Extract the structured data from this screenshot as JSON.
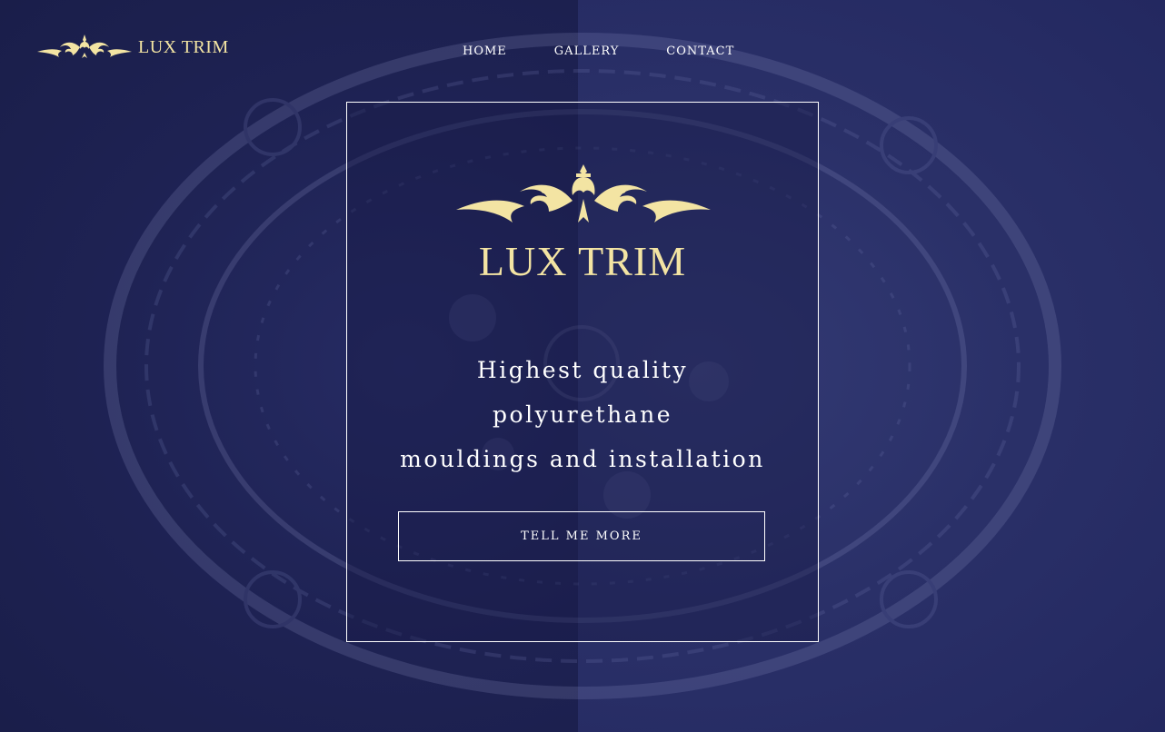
{
  "brand": {
    "name": "LUX TRIM",
    "logo_icon": "scroll-ornament-icon",
    "color": "#f3e4a3"
  },
  "nav": {
    "items": [
      "HOME",
      "GALLERY",
      "CONTACT"
    ]
  },
  "hero": {
    "logo_text": "LUX TRIM",
    "tagline": [
      "Highest quality",
      "polyurethane",
      "mouldings and installation"
    ],
    "cta_label": "TELL ME MORE"
  },
  "colors": {
    "background": "#1f2455",
    "accent": "#f3e4a3",
    "text": "#ffffff"
  }
}
